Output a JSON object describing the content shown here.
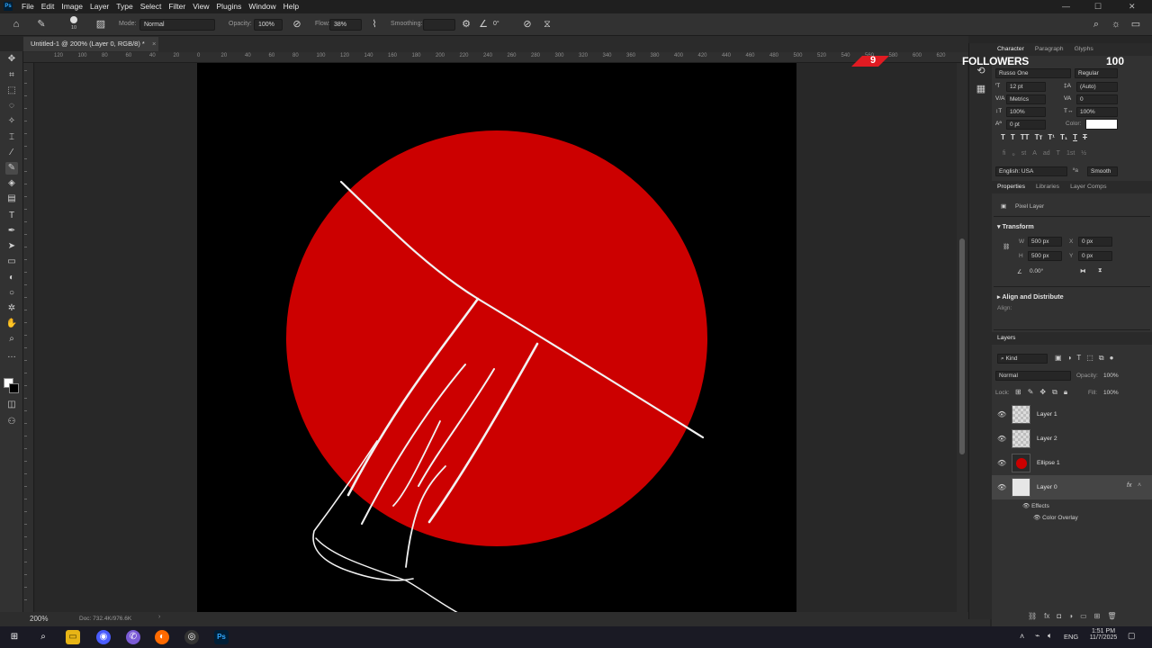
{
  "menu": {
    "app_icon": "Ps",
    "items": [
      "File",
      "Edit",
      "Image",
      "Layer",
      "Type",
      "Select",
      "Filter",
      "View",
      "Plugins",
      "Window",
      "Help"
    ]
  },
  "options_bar": {
    "brush_size": "10",
    "mode_label": "Mode:",
    "mode_value": "Normal",
    "opacity_label": "Opacity:",
    "opacity_value": "100%",
    "flow_label": "Flow:",
    "flow_value": "38%",
    "smoothing_label": "Smoothing:",
    "angle_value": "0°"
  },
  "document": {
    "tab_title": "Untitled-1 @ 200% (Layer 0, RGB/8) *",
    "zoom": "200%",
    "doc_info": "Doc: 732.4K/976.6K"
  },
  "ruler": {
    "ticks": [
      "120",
      "100",
      "80",
      "60",
      "40",
      "20",
      "0",
      "20",
      "40",
      "60",
      "80",
      "100",
      "120",
      "140",
      "160",
      "180",
      "200",
      "220",
      "240",
      "260",
      "280",
      "300",
      "320",
      "340",
      "360",
      "380",
      "400",
      "420",
      "440",
      "460",
      "480",
      "500",
      "520",
      "540",
      "560",
      "580",
      "600",
      "620"
    ]
  },
  "canvas": {
    "circle_color": "#cc0000",
    "background_color": "#000000",
    "stroke_color": "#f2f2f2"
  },
  "overlay": {
    "count_left": "9",
    "label": "FOLLOWERS",
    "count_right": "100",
    "accent": "#e11b22"
  },
  "character_panel": {
    "tabs": [
      "Character",
      "Paragraph",
      "Glyphs"
    ],
    "font_family": "Russo One",
    "font_style": "Regular",
    "font_size": "12 pt",
    "leading": "(Auto)",
    "kerning": "Metrics",
    "tracking": "0",
    "vertical_scale": "100%",
    "horizontal_scale": "100%",
    "baseline_shift": "0 pt",
    "color_label": "Color:",
    "color_value": "#ffffff",
    "style_buttons": [
      "T",
      "T",
      "TT",
      "Tт",
      "T¹",
      "T₁",
      "T",
      "T"
    ],
    "opentype_buttons": [
      "ﬁ",
      "ℴ",
      "st",
      "A",
      "ad",
      "T",
      "1st",
      "½"
    ],
    "language": "English: USA",
    "antialias": "Smooth"
  },
  "properties_panel": {
    "tabs": [
      "Properties",
      "Libraries",
      "Layer Comps"
    ],
    "layer_type": "Pixel Layer",
    "transform_title": "Transform",
    "w_label": "W",
    "w_value": "500 px",
    "h_label": "H",
    "h_value": "500 px",
    "x_label": "X",
    "x_value": "0 px",
    "y_label": "Y",
    "y_value": "0 px",
    "angle_value": "0.00°",
    "align_title": "Align and Distribute",
    "align_label": "Align:"
  },
  "layers_panel": {
    "title": "Layers",
    "filter_kind": "Kind",
    "blend_mode": "Normal",
    "opacity_label": "Opacity:",
    "opacity_value": "100%",
    "lock_label": "Lock:",
    "fill_label": "Fill:",
    "fill_value": "100%",
    "layers": [
      {
        "name": "Layer 1",
        "type": "empty"
      },
      {
        "name": "Layer 2",
        "type": "empty"
      },
      {
        "name": "Ellipse 1",
        "type": "shape"
      },
      {
        "name": "Layer 0",
        "type": "fill",
        "selected": true
      }
    ],
    "fx_label": "fx",
    "effects_label": "Effects",
    "effect_item": "Color Overlay"
  },
  "taskbar": {
    "language": "ENG",
    "time": "1:51 PM",
    "date": "11/7/2025"
  }
}
